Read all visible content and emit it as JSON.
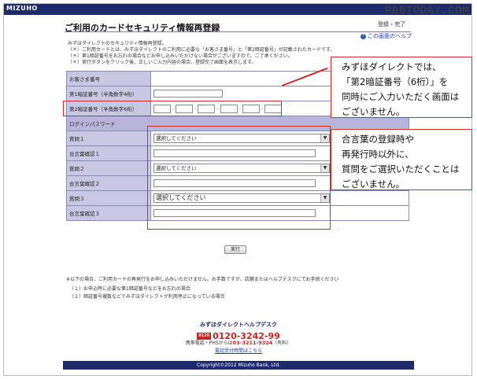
{
  "header": {
    "logo": "MIZUHO",
    "watermark": "RBBTODAY.COM"
  },
  "page": {
    "title": "ご利用のカードセキュリティ情報再登録",
    "step_nav": "登録 › 完了",
    "help_link": "この画面のヘルプ",
    "intro": [
      "みずほダイレクトのセキュリティ情報再登録。",
      "（＊）ご利用カードとは、みずほダイレクトのご利用に必要な「お客さま番号」と「第2暗証番号」が記載されたカードです。",
      "（＊）第1暗証番号をお忘れの場合などお申し込みいただけない場合がございますので、ご了承ください。",
      "（＊）実行ボタンをクリック後、正しいご入力内容の場合、登録完了画面を表示します。"
    ]
  },
  "form": {
    "customer_number_label": "お客さま番号",
    "pin1_label": "第1暗証番号（半角数字4桁）",
    "pin2_label": "第2暗証番号（半角数字6桁）",
    "login_password_label": "ログインパスワード",
    "q1_label": "質問１",
    "q1_selected": "選択してください",
    "a1_label": "合言葉確認１",
    "q2_label": "質問２",
    "q2_selected": "選択してください",
    "a2_label": "合言葉確認２",
    "q3_label": "質問３",
    "q3_selected": "選択してください",
    "a3_label": "合言葉確認３",
    "execute_button": "実行"
  },
  "callouts": {
    "callout1": [
      "みずほダイレクトでは、",
      "「第2暗証番号（6桁）」を",
      "同時にご入力いただく画面は",
      "ございません。"
    ],
    "callout2": [
      "合言葉の登録時や",
      "再発行時以外に、",
      "質問をご選択いただくことは",
      "ございません。"
    ]
  },
  "notes": {
    "heading": "※以下の場合、ご利用カードの再発行をお申し込みいただけません。お手数ですが、店舗またはヘルプデスクにてお手続ください",
    "item1": "（１）お申込時に必要な第1暗証番号などをお忘れの場合",
    "item2": "（２）暗証番号複数などでみずほダイレクトが利用停止になっている場合"
  },
  "helpdesk": {
    "title": "みずほダイレクトヘルプデスク",
    "freedial_badge": "0120",
    "freedial_number": "0120-3242-99",
    "mobile_label": "携帯電話・PHSからは",
    "mobile_number": "03-3211-9324",
    "mobile_note": "（有料）",
    "hours_link": "電話受付時間はこちら"
  },
  "footer": {
    "copyright": "Copyright©2012 Mizuho Bank, Ltd."
  }
}
